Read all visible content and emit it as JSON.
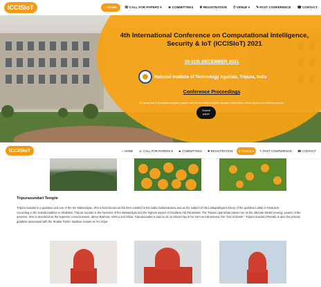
{
  "topnav": {
    "logo": "ICCISIoT",
    "items": [
      {
        "label": "HOME",
        "icon": "home-icon",
        "active": true
      },
      {
        "label": "CALL FOR PAPERS ▾",
        "icon": "call-papers-icon",
        "active": false
      },
      {
        "label": "COMMITTEES",
        "icon": "committees-icon",
        "active": false
      },
      {
        "label": "REGISTRATION",
        "icon": "registration-icon",
        "active": false
      },
      {
        "label": "VENUE ▾",
        "icon": "venue-icon",
        "active": false
      },
      {
        "label": "PAST CONFERENCE",
        "icon": "past-conference-icon",
        "active": false
      },
      {
        "label": "CONTACT",
        "icon": "contact-icon",
        "active": false
      }
    ]
  },
  "hero": {
    "title_line1": "4th International Conference on Computational Intelligence,",
    "title_line2": "Security & IoT (ICCISIoT) 2021",
    "dates": "10-11th DECEMBER 2021",
    "institute": "National Institute of Technology Agartala, Tripura, India",
    "proceedings": "Conference Proceedings",
    "note": "All accepted & presented regular papers will be included in highly reputed publication series (Approval under process).",
    "submit_line1": "Submit",
    "submit_line2": "paper"
  },
  "stickynav": {
    "logo": "ICCISIoT",
    "items": [
      {
        "label": "HOME",
        "icon": "home-icon",
        "active": false
      },
      {
        "label": "CALL FOR PAPERS ▾",
        "icon": "call-papers-icon",
        "active": false
      },
      {
        "label": "COMMITTEES",
        "icon": "committees-icon",
        "active": false
      },
      {
        "label": "REGISTRATION",
        "icon": "registration-icon",
        "active": false
      },
      {
        "label": "VENUE ▾",
        "icon": "venue-icon",
        "active": true
      },
      {
        "label": "PAST CONFERENCE",
        "icon": "past-conference-icon",
        "active": false
      },
      {
        "label": "CONTACT",
        "icon": "contact-icon",
        "active": false
      }
    ]
  },
  "section": {
    "heading": "Tripurasundari Temple",
    "para1": "Tripura Sundari is a goddess and one of the ten Mahavidyas. She is best known as the Devi extolled in the Lalita Sahasranama and as the subject of the Lalitopakhyana (story of the goddess Lalita) in Hinduism.",
    "para2": "According to the Srikula tradition in Shaktism, Tripura Sundari is the foremost of the Mahavidyas and the highest aspect of Goddess Adi Parashakti. The Tripura Upanishad places her as the ultimate Shakti (energy, power) of the universe. She is described as the supreme consciousness, above Brahma, Vishnu and Shiva. Tripurasundari is said to sit on Shiva's lap in his form as Kāmeśvara, the \"lord of desire\". Tripura Sundari (Parvati) is also the primary goddess associated with the Shakta Tantric tradition, known as Sri Vidya."
  },
  "colors": {
    "accent": "#f39a16",
    "overlay": "#f6a214"
  }
}
